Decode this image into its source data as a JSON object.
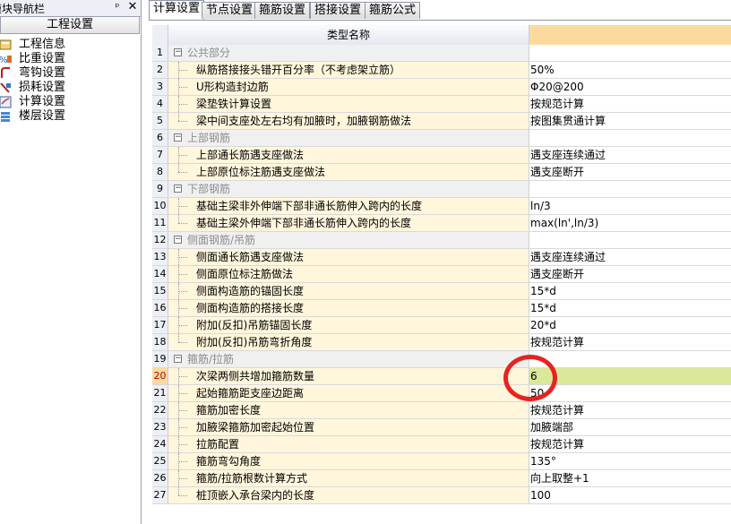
{
  "nav": {
    "title": "模块导航栏",
    "pin_icon": "pin-icon",
    "close_icon": "close-icon",
    "tab": "工程设置",
    "items": [
      {
        "label": "工程信息",
        "icon": "project-info-icon"
      },
      {
        "label": "比重设置",
        "icon": "ratio-icon"
      },
      {
        "label": "弯钩设置",
        "icon": "hook-icon"
      },
      {
        "label": "损耗设置",
        "icon": "loss-icon"
      },
      {
        "label": "计算设置",
        "icon": "calc-icon"
      },
      {
        "label": "楼层设置",
        "icon": "floor-icon"
      }
    ]
  },
  "tabs": [
    "计算设置",
    "节点设置",
    "箍筋设置",
    "搭接设置",
    "箍筋公式"
  ],
  "grid": {
    "header": "类型名称",
    "rows": [
      {
        "n": "1",
        "name": "公共部分",
        "value": "",
        "group": true
      },
      {
        "n": "2",
        "name": "纵筋搭接接头错开百分率（不考虑架立筋）",
        "value": "50%"
      },
      {
        "n": "3",
        "name": "U形构造封边筋",
        "value": "Φ20@200"
      },
      {
        "n": "4",
        "name": "梁垫铁计算设置",
        "value": "按规范计算"
      },
      {
        "n": "5",
        "name": "梁中间支座处左右均有加腋时，加腋钢筋做法",
        "value": "按图集贯通计算"
      },
      {
        "n": "6",
        "name": "上部钢筋",
        "value": "",
        "group": true
      },
      {
        "n": "7",
        "name": "上部通长筋遇支座做法",
        "value": "遇支座连续通过"
      },
      {
        "n": "8",
        "name": "上部原位标注筋遇支座做法",
        "value": "遇支座断开"
      },
      {
        "n": "9",
        "name": "下部钢筋",
        "value": "",
        "group": true
      },
      {
        "n": "10",
        "name": "基础主梁非外伸端下部非通长筋伸入跨内的长度",
        "value": "ln/3"
      },
      {
        "n": "11",
        "name": "基础主梁外伸端下部非通长筋伸入跨内的长度",
        "value": "max(ln',ln/3)"
      },
      {
        "n": "12",
        "name": "侧面钢筋/吊筋",
        "value": "",
        "group": true
      },
      {
        "n": "13",
        "name": "侧面通长筋遇支座做法",
        "value": "遇支座连续通过"
      },
      {
        "n": "14",
        "name": "侧面原位标注筋做法",
        "value": "遇支座断开"
      },
      {
        "n": "15",
        "name": "侧面构造筋的锚固长度",
        "value": "15*d"
      },
      {
        "n": "16",
        "name": "侧面构造筋的搭接长度",
        "value": "15*d"
      },
      {
        "n": "17",
        "name": "附加(反扣)吊筋锚固长度",
        "value": "20*d"
      },
      {
        "n": "18",
        "name": "附加(反扣)吊筋弯折角度",
        "value": "按规范计算"
      },
      {
        "n": "19",
        "name": "箍筋/拉筋",
        "value": "",
        "group": true
      },
      {
        "n": "20",
        "name": "次梁两侧共增加箍筋数量",
        "value": "6",
        "selected": true
      },
      {
        "n": "21",
        "name": "起始箍筋距支座边距离",
        "value": "50"
      },
      {
        "n": "22",
        "name": "箍筋加密长度",
        "value": "按规范计算"
      },
      {
        "n": "23",
        "name": "加腋梁箍筋加密起始位置",
        "value": "加腋端部"
      },
      {
        "n": "24",
        "name": "拉筋配置",
        "value": "按规范计算"
      },
      {
        "n": "25",
        "name": "箍筋弯勾角度",
        "value": "135°"
      },
      {
        "n": "26",
        "name": "箍筋/拉筋根数计算方式",
        "value": "向上取整+1"
      },
      {
        "n": "27",
        "name": "桩顶嵌入承台梁内的长度",
        "value": "100"
      }
    ]
  },
  "colors": {
    "header_value": "#fbdb9d",
    "selected_value": "#dbe89a",
    "annotation_circle": "#e82222"
  }
}
